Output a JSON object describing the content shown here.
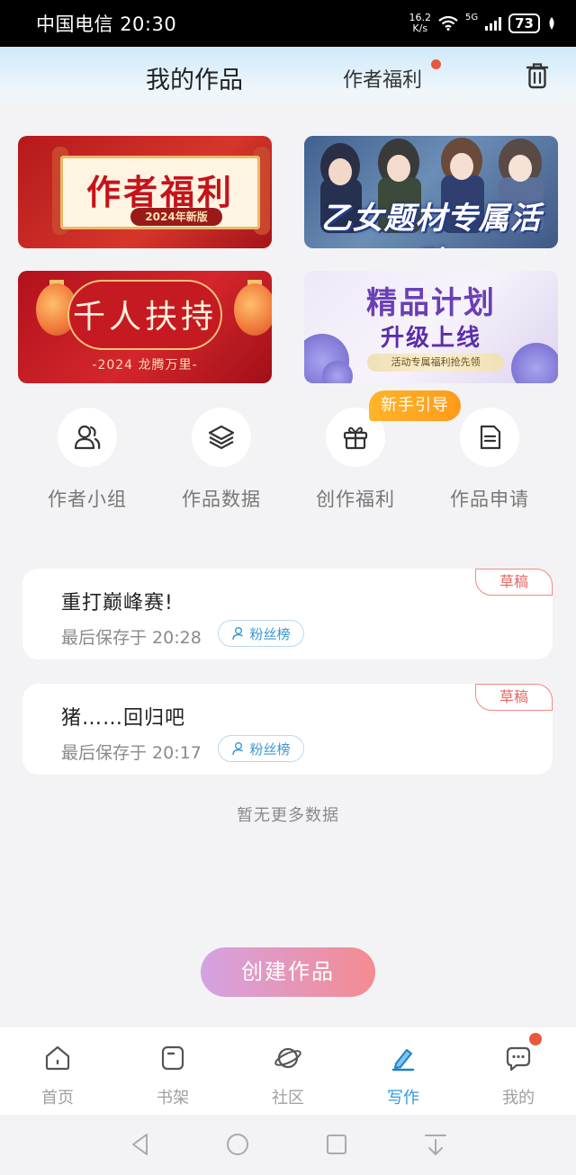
{
  "status_bar": {
    "carrier": "中国电信",
    "time": "20:30",
    "net_speed_value": "16.2",
    "net_speed_unit": "K/s",
    "network": "5G",
    "battery": "73"
  },
  "header": {
    "tab_my_works": "我的作品",
    "tab_author_welfare": "作者福利",
    "trash_icon": "trash-icon"
  },
  "banners": {
    "welfare": {
      "title": "作者福利",
      "subtitle": "2024年新版"
    },
    "otome": {
      "title": "乙女题材专属活动"
    },
    "support": {
      "title": "千人扶持",
      "subtitle": "-2024 龙腾万里-"
    },
    "quality": {
      "title": "精品计划",
      "subtitle": "升级上线",
      "tag": "活动专属福利抢先领"
    }
  },
  "quick_actions": [
    {
      "label": "作者小组",
      "icon": "group-icon"
    },
    {
      "label": "作品数据",
      "icon": "layers-icon"
    },
    {
      "label": "创作福利",
      "icon": "gift-icon"
    },
    {
      "label": "作品申请",
      "icon": "document-icon"
    }
  ],
  "newbie_badge": "新手引导",
  "drafts": [
    {
      "title": "重打巅峰赛!",
      "saved": "最后保存于 20:28",
      "fan_label": "粉丝榜",
      "tag": "草稿"
    },
    {
      "title": "猪……回归吧",
      "saved": "最后保存于 20:17",
      "fan_label": "粉丝榜",
      "tag": "草稿"
    }
  ],
  "no_more": "暂无更多数据",
  "create_button": "创建作品",
  "bottom_nav": [
    {
      "label": "首页",
      "icon": "home-icon"
    },
    {
      "label": "书架",
      "icon": "bookshelf-icon"
    },
    {
      "label": "社区",
      "icon": "planet-icon"
    },
    {
      "label": "写作",
      "icon": "pen-icon",
      "active": true
    },
    {
      "label": "我的",
      "icon": "message-icon"
    }
  ],
  "colors": {
    "accent": "#2e9be0",
    "badge_red": "#e7583f",
    "draft_tag": "#e76763",
    "newbie_orange": "#ffa51f"
  }
}
